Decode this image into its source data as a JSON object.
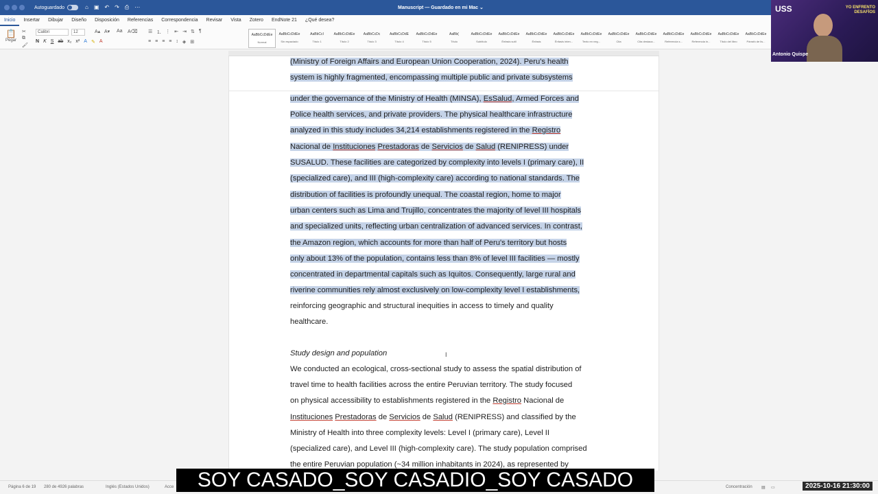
{
  "titlebar": {
    "autosave_label": "Autoguardado",
    "autosave_state": "off",
    "doc_title": "Manuscript — Guardado en mi Mac ⌄"
  },
  "tabs": [
    {
      "label": "Inicio",
      "active": true
    },
    {
      "label": "Insertar"
    },
    {
      "label": "Dibujar"
    },
    {
      "label": "Diseño"
    },
    {
      "label": "Disposición"
    },
    {
      "label": "Referencias"
    },
    {
      "label": "Correspondencia"
    },
    {
      "label": "Revisar"
    },
    {
      "label": "Vista"
    },
    {
      "label": "Zotero"
    },
    {
      "label": "EndNote 21"
    },
    {
      "label": "¿Qué desea?"
    }
  ],
  "ribbon": {
    "paste_label": "Pegar",
    "font_name": "Calibri",
    "font_size": "12",
    "styles": [
      {
        "sample": "AaBbCcDdEe",
        "name": "Normal"
      },
      {
        "sample": "AaBbCcDdEe",
        "name": "Sin espaciado"
      },
      {
        "sample": "AaBbCcI",
        "name": "Título 1"
      },
      {
        "sample": "AaBbCcDdEe",
        "name": "Título 2"
      },
      {
        "sample": "AaBbCcDc",
        "name": "Título 3"
      },
      {
        "sample": "AaBbCcDdE",
        "name": "Título 4"
      },
      {
        "sample": "AaBbCcDdEe",
        "name": "Título 5"
      },
      {
        "sample": "AaBb(",
        "name": "Título"
      },
      {
        "sample": "AaBbCcDdEe",
        "name": "Subtítulo"
      },
      {
        "sample": "AaBbCcDdEe",
        "name": "Énfasis sutil"
      },
      {
        "sample": "AaBbCcDdEe",
        "name": "Énfasis"
      },
      {
        "sample": "AaBbCcDdEe",
        "name": "Énfasis inten..."
      },
      {
        "sample": "AaBbCcDdEe",
        "name": "Texto en neg..."
      },
      {
        "sample": "AaBbCcDdEe",
        "name": "Cita"
      },
      {
        "sample": "AaBbCcDdEe",
        "name": "Cita destaca..."
      },
      {
        "sample": "AaBbCcDdEe",
        "name": "Referencia s..."
      },
      {
        "sample": "AaBbCcDdEe",
        "name": "Referencia in..."
      },
      {
        "sample": "AaBbCcDdEe",
        "name": "Título del libro"
      },
      {
        "sample": "AaBbCcDdEe",
        "name": "Párrafo de lis..."
      }
    ]
  },
  "document": {
    "lines": [
      {
        "segments": [
          {
            "t": "(Ministry of Foreign Affairs and European Union Cooperation, 2024). Peru's health"
          }
        ],
        "selected": true
      },
      {
        "segments": [
          {
            "t": "system is highly fragmented, encompassing multiple public and private subsystems"
          }
        ],
        "selected": true
      },
      {
        "segments": [
          {
            "t": "under the governance of the Ministry of Health (MINSA), "
          },
          {
            "t": "EsSalud",
            "u": true
          },
          {
            "t": ", Armed Forces and"
          }
        ],
        "selected": true
      },
      {
        "segments": [
          {
            "t": "Police health services, and private providers. The physical healthcare infrastructure"
          }
        ],
        "selected": true
      },
      {
        "segments": [
          {
            "t": "analyzed in this study includes 34,214 establishments registered in the "
          },
          {
            "t": "Registro",
            "u": true
          }
        ],
        "selected": true
      },
      {
        "segments": [
          {
            "t": "Nacional de "
          },
          {
            "t": "Instituciones",
            "u": true
          },
          {
            "t": " "
          },
          {
            "t": "Prestadoras",
            "u": true
          },
          {
            "t": " de "
          },
          {
            "t": "Servicios",
            "u": true
          },
          {
            "t": " de "
          },
          {
            "t": "Salud",
            "u": true
          },
          {
            "t": " (RENIPRESS) under"
          }
        ],
        "selected": true
      },
      {
        "segments": [
          {
            "t": "SUSALUD. These facilities are categorized by complexity into levels I (primary care), II"
          }
        ],
        "selected": true
      },
      {
        "segments": [
          {
            "t": "(specialized care), and III (high-complexity care) according to national standards. The"
          }
        ],
        "selected": true
      },
      {
        "segments": [
          {
            "t": "distribution of facilities is profoundly unequal. The coastal region, home to major"
          }
        ],
        "selected": true
      },
      {
        "segments": [
          {
            "t": "urban centers such as Lima and Trujillo, concentrates the majority of level III hospitals"
          }
        ],
        "selected": true
      },
      {
        "segments": [
          {
            "t": "and specialized units, reflecting urban centralization of advanced services. In contrast,"
          }
        ],
        "selected": true
      },
      {
        "segments": [
          {
            "t": "the Amazon region, which accounts for more than half of Peru's territory but hosts"
          }
        ],
        "selected": true
      },
      {
        "segments": [
          {
            "t": "only about 13% of the population, contains less than 8% of level III facilities — mostly"
          }
        ],
        "selected": true
      },
      {
        "segments": [
          {
            "t": "concentrated in departmental capitals such as Iquitos. Consequently, large rural and"
          }
        ],
        "selected": true
      },
      {
        "segments": [
          {
            "t": "riverine communities rely almost exclusively on low-complexity level I establishments,"
          }
        ],
        "selected": true
      },
      {
        "segments": [
          {
            "t": "reinforcing geographic and structural inequities in access to timely and quality"
          }
        ],
        "selected": false
      },
      {
        "segments": [
          {
            "t": "healthcare."
          }
        ],
        "selected": false
      },
      {
        "segments": [
          {
            "t": "Study design and population",
            "i": true
          }
        ],
        "selected": false
      },
      {
        "segments": [
          {
            "t": "We conducted an ecological, cross-sectional study to assess the spatial distribution of"
          }
        ],
        "selected": false
      },
      {
        "segments": [
          {
            "t": "travel time to health facilities across the entire Peruvian territory. The study focused"
          }
        ],
        "selected": false
      },
      {
        "segments": [
          {
            "t": "on physical accessibility to establishments registered in the "
          },
          {
            "t": "Registro",
            "u": true
          },
          {
            "t": " Nacional de"
          }
        ],
        "selected": false
      },
      {
        "segments": [
          {
            "t": "Instituciones",
            "u": true
          },
          {
            "t": " "
          },
          {
            "t": "Prestadoras",
            "u": true
          },
          {
            "t": " de "
          },
          {
            "t": "Servicios",
            "u": true
          },
          {
            "t": " de "
          },
          {
            "t": "Salud",
            "u": true
          },
          {
            "t": " (RENIPRESS) and classified by the"
          }
        ],
        "selected": false
      },
      {
        "segments": [
          {
            "t": "Ministry of Health into three complexity levels: Level I (primary care), Level II"
          }
        ],
        "selected": false
      },
      {
        "segments": [
          {
            "t": "(specialized care), and Level III (high-complexity care). The study population comprised"
          }
        ],
        "selected": false
      },
      {
        "segments": [
          {
            "t": "the entire Peruvian population (~34 million inhabitants in 2024), as represented by"
          }
        ],
        "selected": false
      }
    ]
  },
  "webcam": {
    "logo": "USS",
    "banner": "YO ENFRENTO DESAFÍOS",
    "name": "Antonio Quispe"
  },
  "statusbar": {
    "page": "Página 6 de 19",
    "words": "280 de 4926 palabras",
    "language": "Inglés (Estados Unidos)",
    "accessibility": "Acce",
    "focus": "Concentración",
    "datetime": "2025-10-16 21:30:00"
  },
  "caption": "SOY CASADO_SOY CASADIO_SOY CASADO"
}
